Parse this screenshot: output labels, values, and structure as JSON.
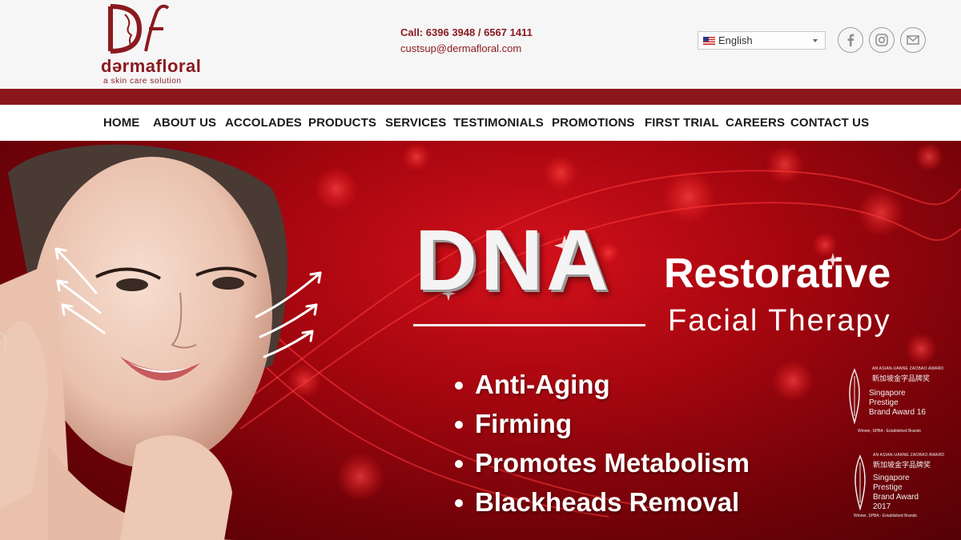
{
  "brand": {
    "name": "dərmafloral",
    "tagline": "a skin care solution",
    "color": "#8a1a1f"
  },
  "contact": {
    "phone": "Call: 6396 3948 / 6567 1411",
    "email": "custsup@dermafloral.com"
  },
  "language": {
    "selected": "English",
    "flag_icon": "us-flag-icon"
  },
  "social": [
    {
      "name": "facebook-icon"
    },
    {
      "name": "instagram-icon"
    },
    {
      "name": "email-icon"
    }
  ],
  "nav": {
    "items": [
      "HOME",
      "ABOUT US",
      "ACCOLADES",
      "PRODUCTS",
      "SERVICES",
      "TESTIMONIALS",
      "PROMOTIONS",
      "FIRST TRIAL",
      "CAREERS",
      "CONTACT US"
    ]
  },
  "hero": {
    "title": "DNA",
    "subtitle_bold": "Restorative",
    "subtitle_light": "Facial Therapy",
    "bullets": [
      "Anti-Aging",
      "Firming",
      "Promotes Metabolism",
      "Blackheads Removal"
    ],
    "awards": [
      {
        "top": "AN ASIAN-UANNE ZAOBAO AWARD",
        "chinese": "新加坡金字品牌奖",
        "line1": "Singapore",
        "line2": "Prestige",
        "line3": "Brand Award 16",
        "footer": "Winner, SPBA - Established Brands"
      },
      {
        "top": "AN ASIAN-UANNE ZAOBAO AWARD",
        "chinese": "新加坡金字品牌奖",
        "line1": "Singapore",
        "line2": "Prestige",
        "line3": "Brand Award",
        "line4": "2017",
        "footer": "Winner, SPBA - Established Brands"
      }
    ],
    "background_color": "#a5060f"
  }
}
